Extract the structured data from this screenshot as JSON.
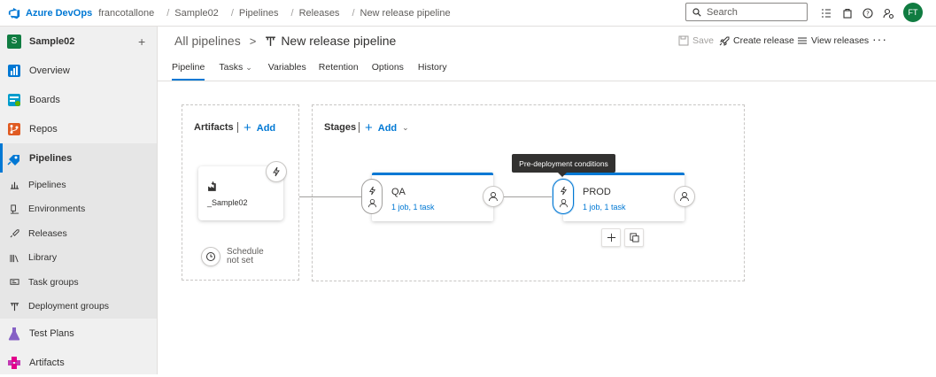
{
  "topbar": {
    "brand": "Azure DevOps",
    "breadcrumbs": [
      "francotallone",
      "Sample02",
      "Pipelines",
      "Releases",
      "New release pipeline"
    ],
    "search_placeholder": "Search",
    "avatar_initials": "FT"
  },
  "sidebar": {
    "project_initial": "S",
    "project_name": "Sample02",
    "items": [
      {
        "label": "Overview",
        "icon": "overview-icon",
        "color": "#0078d4"
      },
      {
        "label": "Boards",
        "icon": "boards-icon",
        "color": "#009ccc"
      },
      {
        "label": "Repos",
        "icon": "repos-icon",
        "color": "#e05b22"
      },
      {
        "label": "Pipelines",
        "icon": "pipelines-icon",
        "color": "#0078d4",
        "active": true
      }
    ],
    "pipelines_sub": [
      {
        "label": "Pipelines",
        "icon": "pipelines-sub-icon"
      },
      {
        "label": "Environments",
        "icon": "environments-icon"
      },
      {
        "label": "Releases",
        "icon": "releases-icon"
      },
      {
        "label": "Library",
        "icon": "library-icon"
      },
      {
        "label": "Task groups",
        "icon": "task-groups-icon"
      },
      {
        "label": "Deployment groups",
        "icon": "deployment-groups-icon"
      }
    ],
    "items_after": [
      {
        "label": "Test Plans",
        "icon": "test-plans-icon",
        "color": "#8661c5"
      },
      {
        "label": "Artifacts",
        "icon": "artifacts-icon",
        "color": "#c239b3"
      }
    ]
  },
  "header": {
    "all_pipelines": "All pipelines",
    "title": "New release pipeline",
    "actions": {
      "save": "Save",
      "create_release": "Create release",
      "view_releases": "View releases"
    },
    "tabs": [
      "Pipeline",
      "Tasks",
      "Variables",
      "Retention",
      "Options",
      "History"
    ],
    "active_tab": "Pipeline"
  },
  "canvas": {
    "artifacts": {
      "title": "Artifacts",
      "add_label": "Add",
      "artifact_name": "_Sample02",
      "schedule_line1": "Schedule",
      "schedule_line2": "not set"
    },
    "stages": {
      "title": "Stages",
      "add_label": "Add",
      "items": [
        {
          "name": "QA",
          "tasks": "1 job, 1 task"
        },
        {
          "name": "PROD",
          "tasks": "1 job, 1 task"
        }
      ]
    },
    "tooltip": "Pre-deployment conditions"
  },
  "colors": {
    "accent": "#0078d4",
    "project_badge": "#107c41"
  }
}
